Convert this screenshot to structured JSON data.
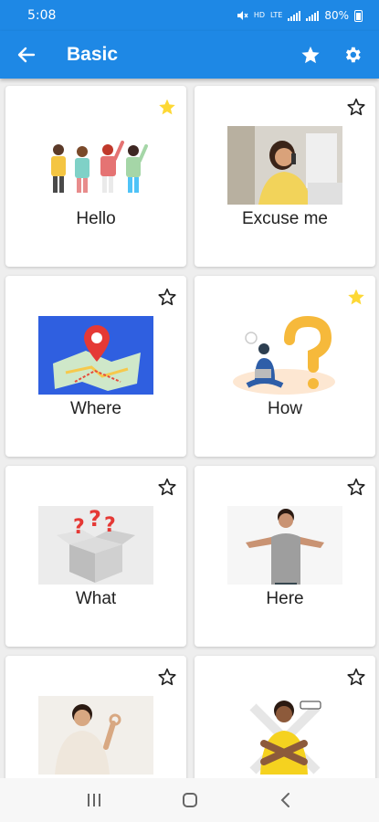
{
  "status_bar": {
    "time": "5:08",
    "hd": "HD",
    "lte": "LTE",
    "battery": "80%"
  },
  "app_bar": {
    "title": "Basic",
    "back_icon": "arrow-left-icon",
    "favorites_icon": "star-icon",
    "settings_icon": "gear-icon"
  },
  "colors": {
    "primary": "#1e88e5",
    "favorite_active": "#fdd835",
    "favorite_inactive": "#222222"
  },
  "cards": [
    {
      "label": "Hello",
      "favorite": true
    },
    {
      "label": "Excuse me",
      "favorite": false
    },
    {
      "label": "Where",
      "favorite": false
    },
    {
      "label": "How",
      "favorite": true
    },
    {
      "label": "What",
      "favorite": false
    },
    {
      "label": "Here",
      "favorite": false
    },
    {
      "label": "",
      "favorite": false
    },
    {
      "label": "",
      "favorite": false
    }
  ],
  "nav_bar": {
    "recents_icon": "recents-icon",
    "home_icon": "home-icon",
    "back_icon": "chevron-left-icon"
  }
}
